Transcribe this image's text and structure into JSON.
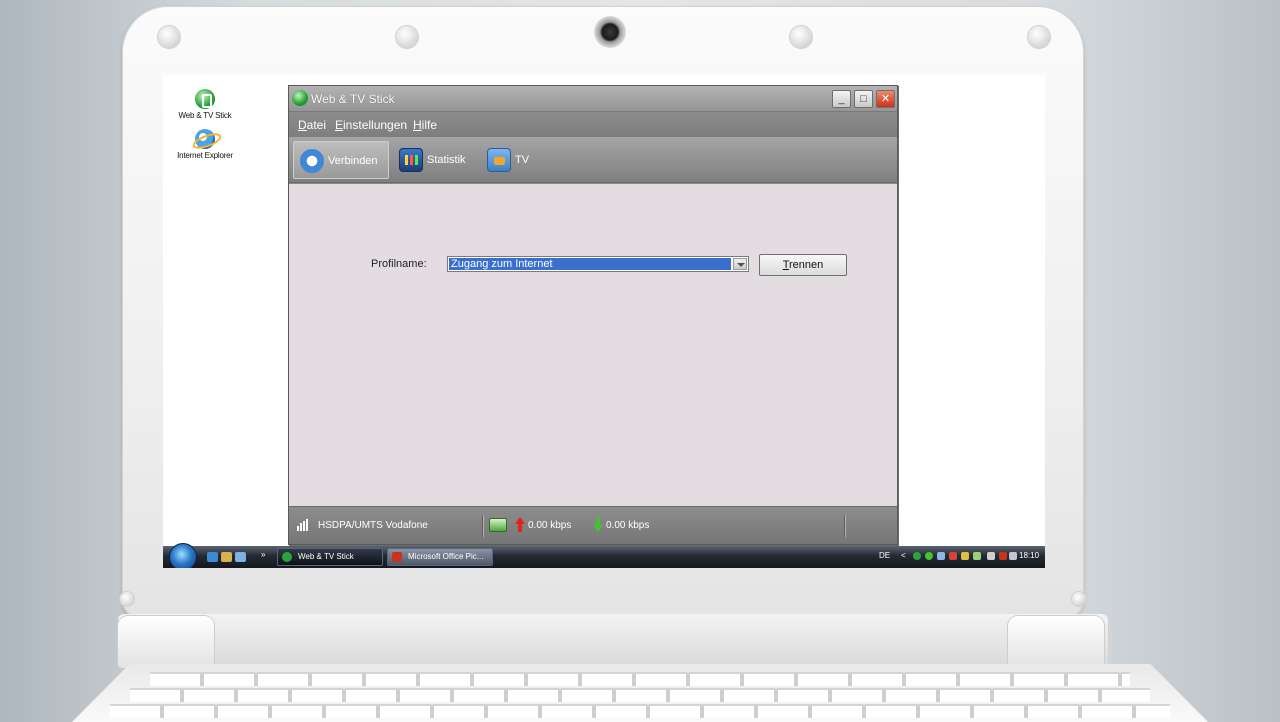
{
  "desktop": {
    "icons": [
      {
        "label": "Web & TV Stick"
      },
      {
        "label": "Internet Explorer"
      }
    ]
  },
  "window": {
    "title": "Web & TV Stick",
    "controls": {
      "minimize": "_",
      "maximize": "□",
      "close": "✕"
    },
    "menu": [
      {
        "accel": "D",
        "rest": "atei"
      },
      {
        "accel": "E",
        "rest": "instellungen"
      },
      {
        "accel": "H",
        "rest": "ilfe"
      }
    ],
    "toolbar": {
      "connect": "Verbinden",
      "stats": "Statistik",
      "tv": "TV"
    },
    "profile": {
      "label": "Profilname:",
      "value": "Zugang zum Internet"
    },
    "disconnect_button": {
      "accel": "T",
      "rest": "rennen"
    },
    "status": {
      "network": "HSDPA/UMTS Vodafone",
      "upload": "0.00 kbps",
      "download": "0.00 kbps"
    }
  },
  "taskbar": {
    "tasks": [
      {
        "label": "Web & TV Stick"
      },
      {
        "label": "Microsoft Office Pic..."
      }
    ],
    "overflow": "»",
    "language": "DE",
    "tray_chevron": "<",
    "time": "18:10"
  },
  "colors": {
    "selection": "#3a6fd0",
    "upload_arrow": "#e0231b",
    "download_arrow": "#43c232"
  }
}
